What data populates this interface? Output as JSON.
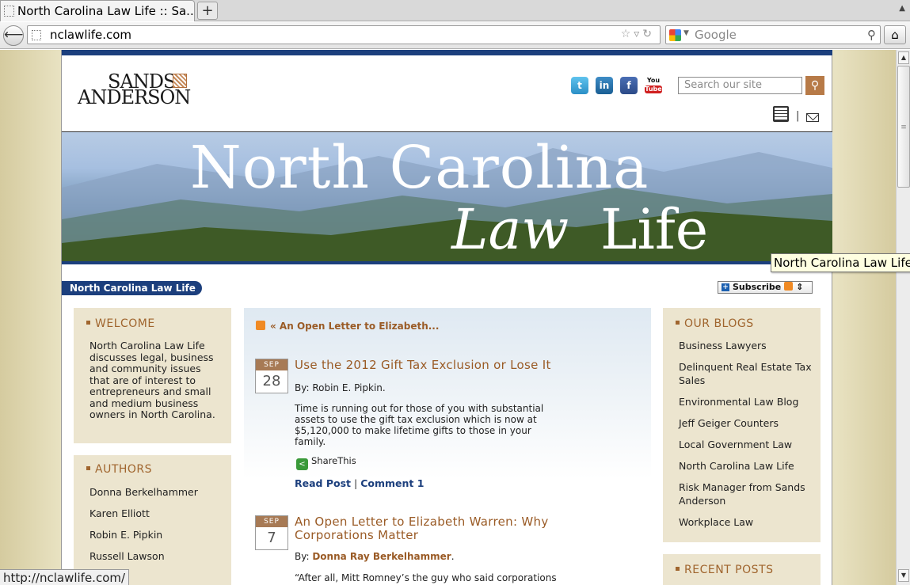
{
  "browser": {
    "tab_title": "North Carolina Law Life :: Sa...",
    "new_tab_label": "+",
    "url": "nclawlife.com",
    "search_engine": "Google",
    "status_url": "http://nclawlife.com/"
  },
  "header": {
    "logo_line1": "SANDS",
    "logo_line2": "ANDERSON",
    "social": [
      {
        "name": "Twitter",
        "glyph": "t"
      },
      {
        "name": "LinkedIn",
        "glyph": "in"
      },
      {
        "name": "Facebook",
        "glyph": "f"
      },
      {
        "name": "YouTube",
        "glyph_top": "You",
        "glyph_bottom": "Tube"
      }
    ],
    "search_placeholder": "Search our site",
    "tool_separator": "|"
  },
  "banner": {
    "line1": "North Carolina",
    "line2_italic": "Law",
    "line2_rest": "Life",
    "tooltip": "North Carolina Law Life"
  },
  "blog_bar": {
    "title": "North Carolina Law Life",
    "subscribe_label": "Subscribe"
  },
  "welcome": {
    "heading": "WELCOME",
    "body": "North Carolina Law Life discusses legal, business and community issues that are of interest to entrepreneurs and small and medium business owners in North Carolina."
  },
  "authors": {
    "heading": "AUTHORS",
    "items": [
      "Donna Berkelhammer",
      "Karen Elliott",
      "Robin E. Pipkin",
      "Russell Lawson"
    ]
  },
  "main": {
    "prev_link": "« An Open Letter to Elizabeth...",
    "posts": [
      {
        "month": "SEP",
        "day": "28",
        "title": "Use the 2012 Gift Tax Exclusion or Lose It",
        "by_label": "By:",
        "author": "Robin E. Pipkin.",
        "excerpt": "Time is running out for those of you with substantial assets to use the gift tax exclusion which is now at $5,120,000 to make lifetime gifts to those in your family.",
        "share_label": "ShareThis",
        "read_label": "Read Post",
        "separator": "|",
        "comment_label": "Comment 1"
      },
      {
        "month": "SEP",
        "day": "7",
        "title": "An Open Letter to Elizabeth Warren: Why Corporations Matter",
        "by_label": "By:",
        "author": "Donna Ray Berkelhammer",
        "author_suffix": ".",
        "excerpt": "“After all, Mitt Romney’s the guy who said corporations"
      }
    ]
  },
  "our_blogs": {
    "heading": "OUR BLOGS",
    "items": [
      "Business Lawyers",
      "Delinquent Real Estate Tax Sales",
      "Environmental Law Blog",
      "Jeff Geiger Counters",
      "Local Government Law",
      "North Carolina Law Life",
      "Risk Manager from Sands Anderson",
      "Workplace Law"
    ]
  },
  "recent_posts": {
    "heading": "RECENT POSTS"
  },
  "colors": {
    "navy": "#1c3f7d",
    "accent_brown": "#9a5b26",
    "sidebar_bg": "#ece5cf"
  }
}
